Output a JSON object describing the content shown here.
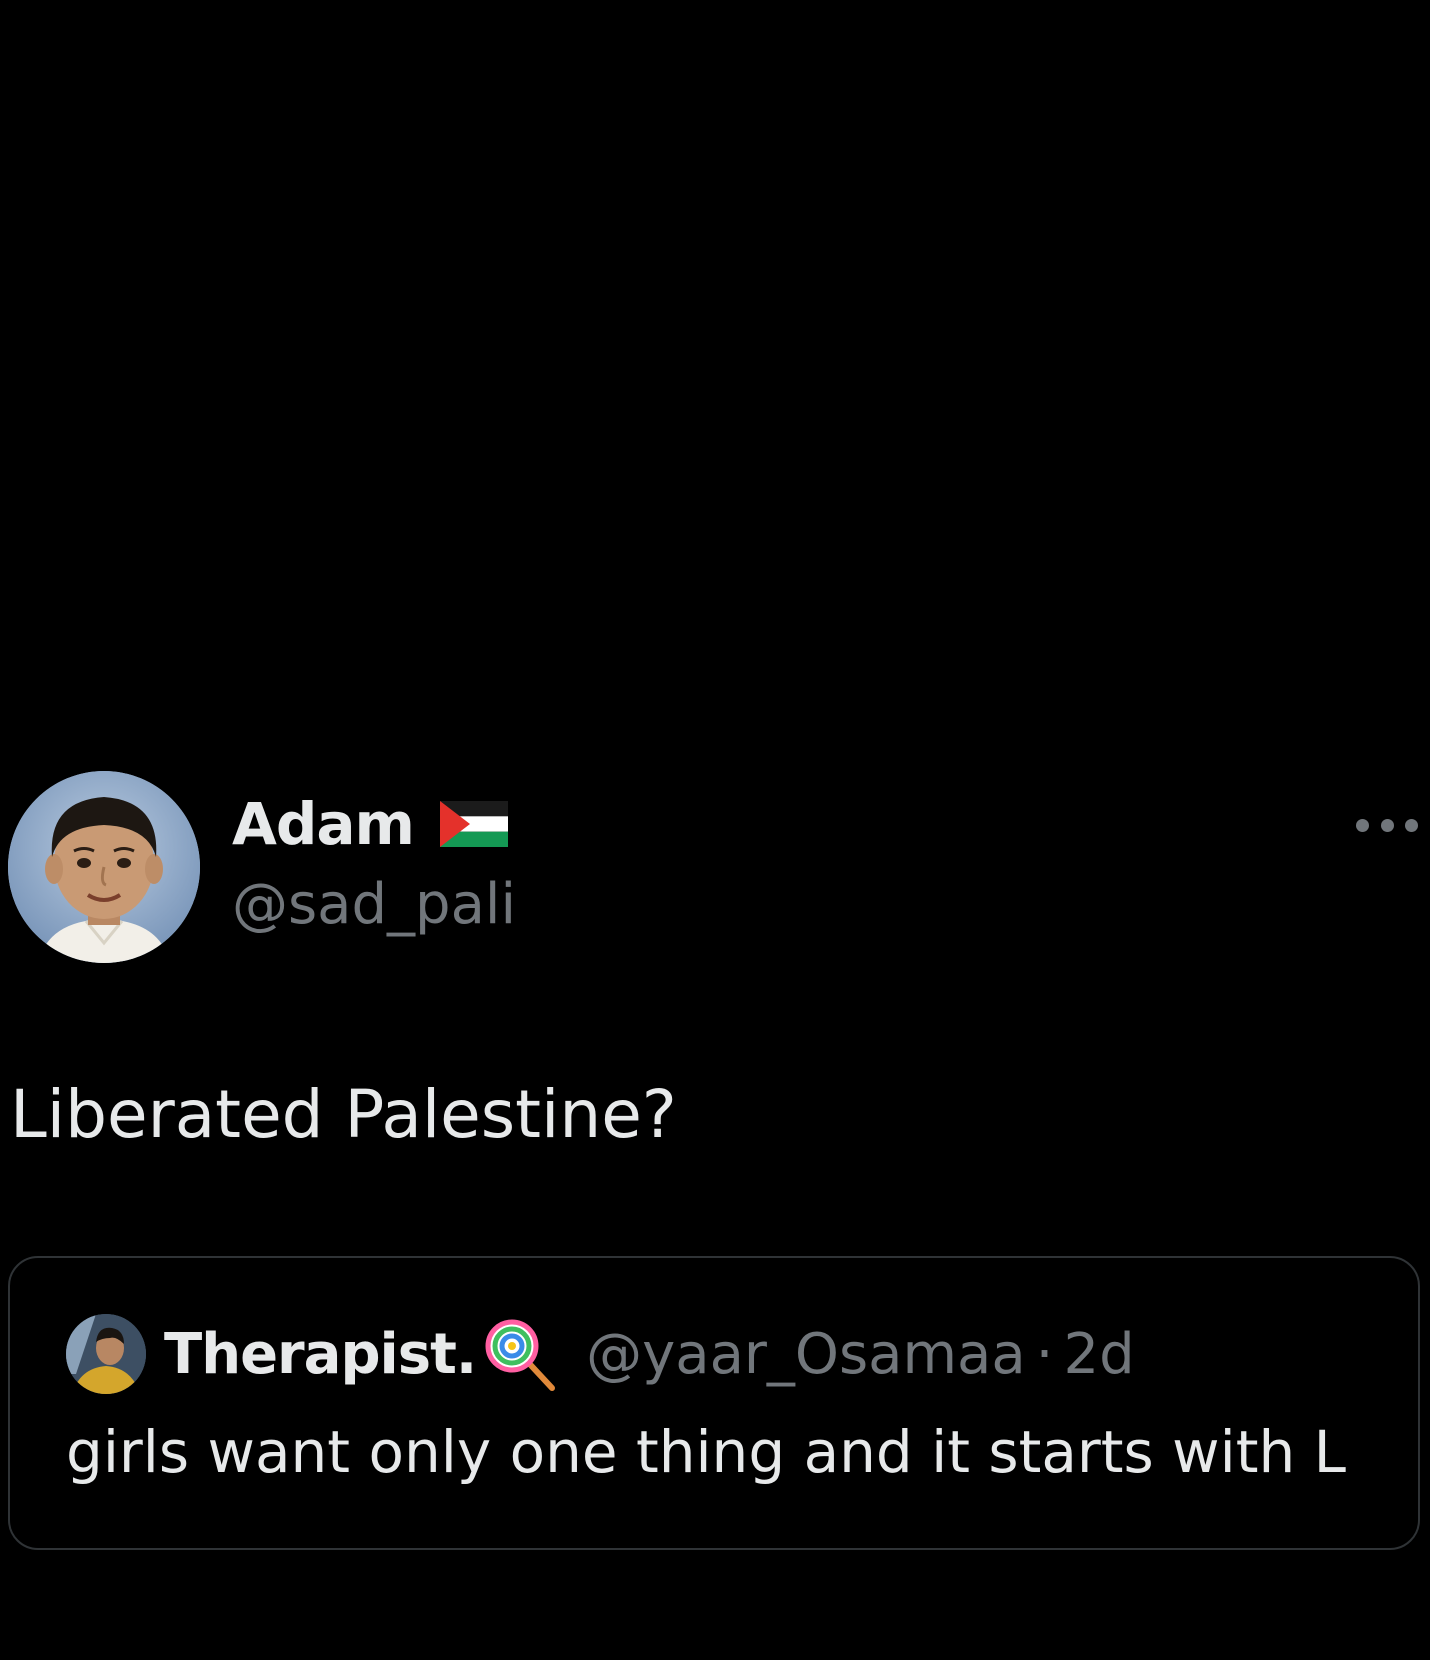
{
  "tweet": {
    "author": {
      "display_name": "Adam",
      "flag_icon": "palestine-flag-icon",
      "handle": "@sad_pali"
    },
    "text": "Liberated Palestine?",
    "more_icon": "more-horizontal-icon",
    "quoted": {
      "display_name": "Therapist.",
      "emoji_icon": "lollipop-icon",
      "handle": "@yaar_Osamaa",
      "separator": "·",
      "time": "2d",
      "text": "girls want only one thing and it starts with L"
    }
  },
  "colors": {
    "background": "#000000",
    "primary_text": "#e7e9ea",
    "secondary_text": "#71767b",
    "border": "#2f3336",
    "flag_red": "#e4312b",
    "flag_green": "#149954"
  }
}
